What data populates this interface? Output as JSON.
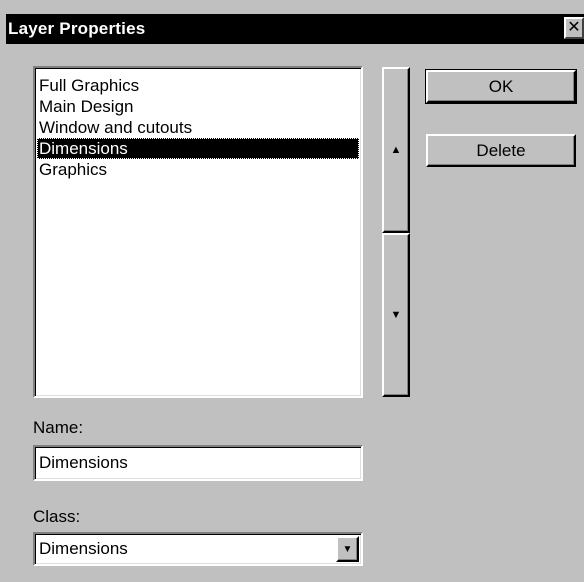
{
  "window": {
    "title": "Layer Properties",
    "close_glyph": "✕"
  },
  "layers": {
    "items": [
      {
        "label": "Full Graphics",
        "selected": false
      },
      {
        "label": "Main Design",
        "selected": false
      },
      {
        "label": "Window and cutouts",
        "selected": false
      },
      {
        "label": "Dimensions",
        "selected": true
      },
      {
        "label": "Graphics",
        "selected": false
      }
    ]
  },
  "order_buttons": {
    "up_glyph": "▲",
    "down_glyph": "▼"
  },
  "buttons": {
    "ok_label": "OK",
    "delete_label": "Delete"
  },
  "name_field": {
    "label": "Name:",
    "value": "Dimensions"
  },
  "class_field": {
    "label": "Class:",
    "value": "Dimensions",
    "arrow_glyph": "▼"
  },
  "colors": {
    "face": "#c0c0c0",
    "selection": "#000000",
    "title_bar": "#000000"
  }
}
